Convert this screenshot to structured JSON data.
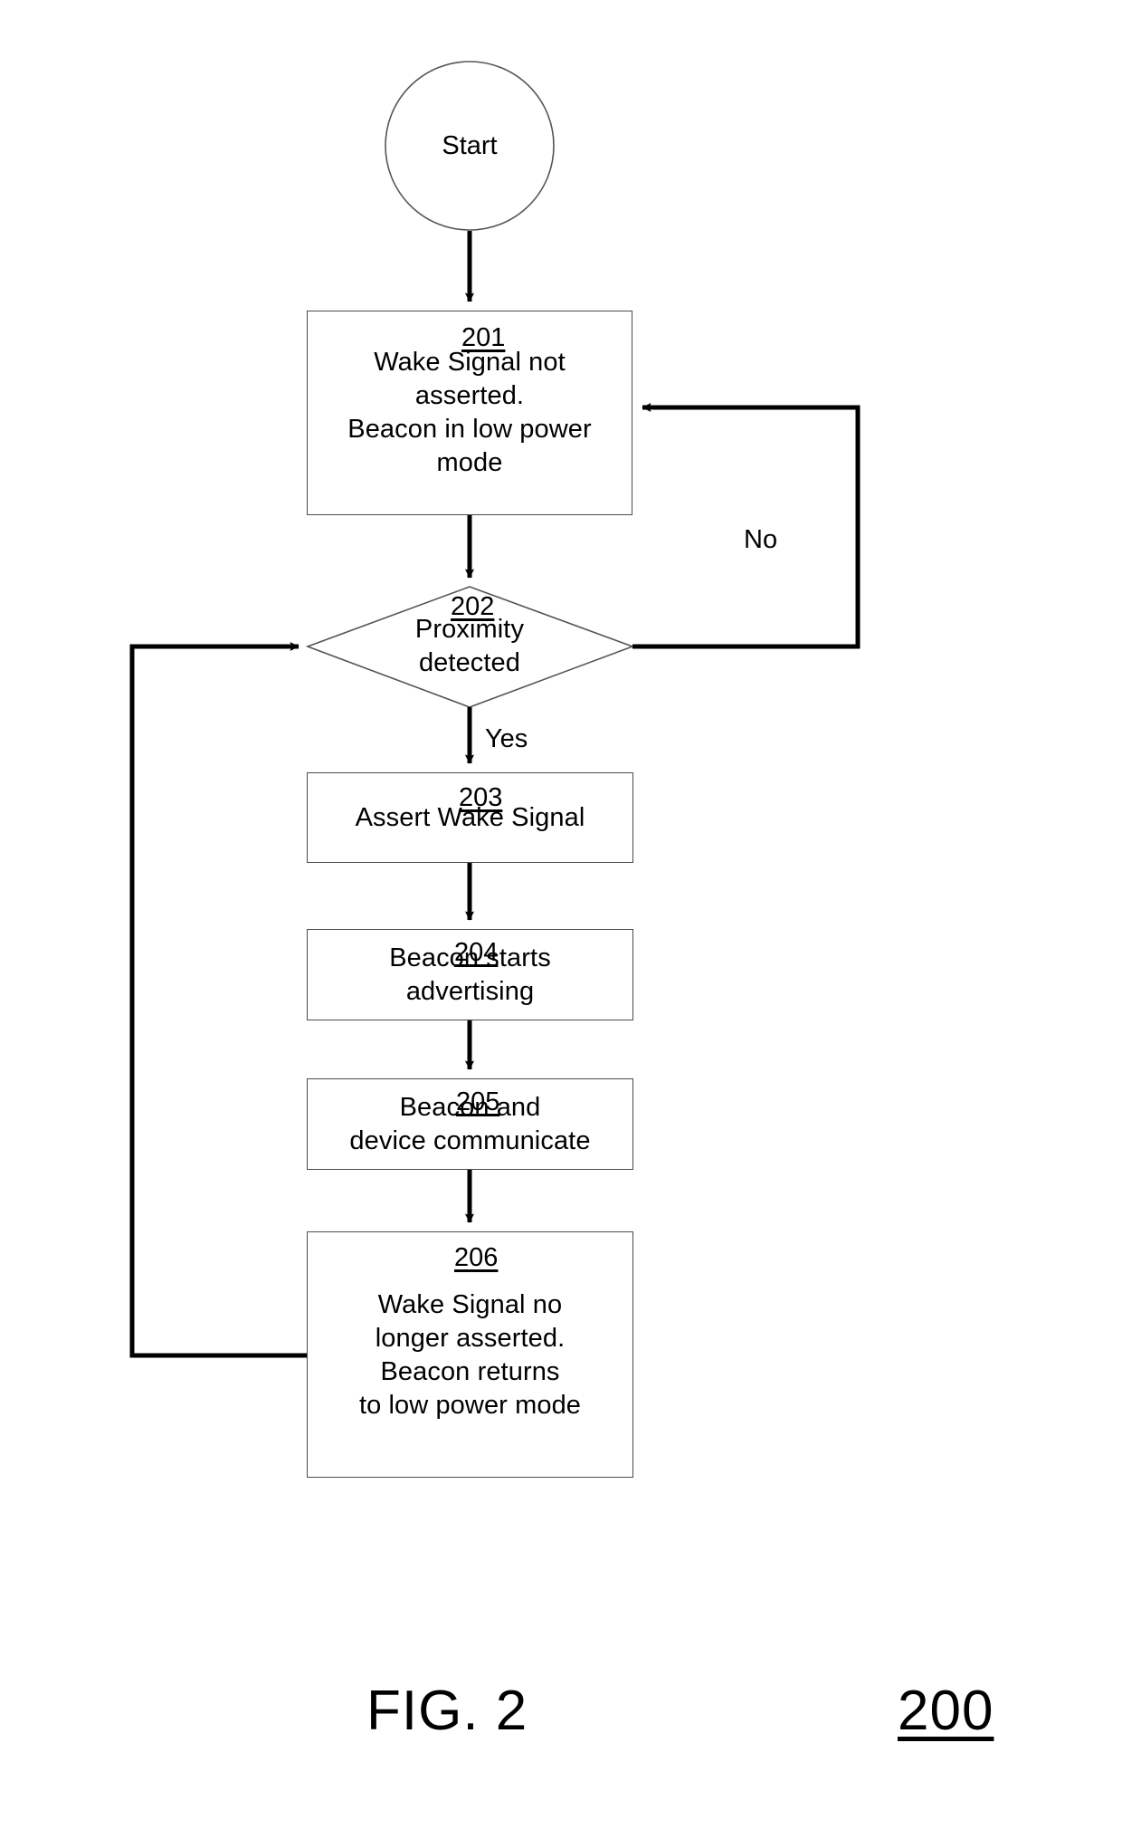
{
  "figure": {
    "caption": "FIG. 2",
    "figure_ref": "200"
  },
  "nodes": [
    {
      "id": "start",
      "shape": "circle",
      "label": "Start",
      "ref": null
    },
    {
      "id": "n201",
      "shape": "process",
      "label": "Wake Signal not\nasserted.\nBeacon in low power\nmode",
      "ref": "201"
    },
    {
      "id": "n202",
      "shape": "decision",
      "label": "Proximity\ndetected",
      "ref": "202"
    },
    {
      "id": "n203",
      "shape": "process",
      "label": "Assert Wake Signal",
      "ref": "203"
    },
    {
      "id": "n204",
      "shape": "process",
      "label": "Beacon starts\nadvertising",
      "ref": "204"
    },
    {
      "id": "n205",
      "shape": "process",
      "label": "Beacon and\ndevice communicate",
      "ref": "205"
    },
    {
      "id": "n206",
      "shape": "process",
      "label": "Wake Signal no\nlonger asserted.\nBeacon returns\nto low power mode",
      "ref": "206"
    }
  ],
  "edges": [
    {
      "id": "e-start-201",
      "from": "start",
      "to": "n201",
      "label": ""
    },
    {
      "id": "e-201-202",
      "from": "n201",
      "to": "n202",
      "label": ""
    },
    {
      "id": "e-202-201-no",
      "from": "n202",
      "to": "n201",
      "label": "No"
    },
    {
      "id": "e-202-203-yes",
      "from": "n202",
      "to": "n203",
      "label": "Yes"
    },
    {
      "id": "e-203-204",
      "from": "n203",
      "to": "n204",
      "label": ""
    },
    {
      "id": "e-204-205",
      "from": "n204",
      "to": "n205",
      "label": ""
    },
    {
      "id": "e-205-206",
      "from": "n205",
      "to": "n206",
      "label": ""
    },
    {
      "id": "e-206-202",
      "from": "n206",
      "to": "n202",
      "label": ""
    }
  ],
  "colors": {
    "stroke": "#000000",
    "box_border": "#4a4a4a",
    "background": "#ffffff",
    "text": "#000000"
  }
}
